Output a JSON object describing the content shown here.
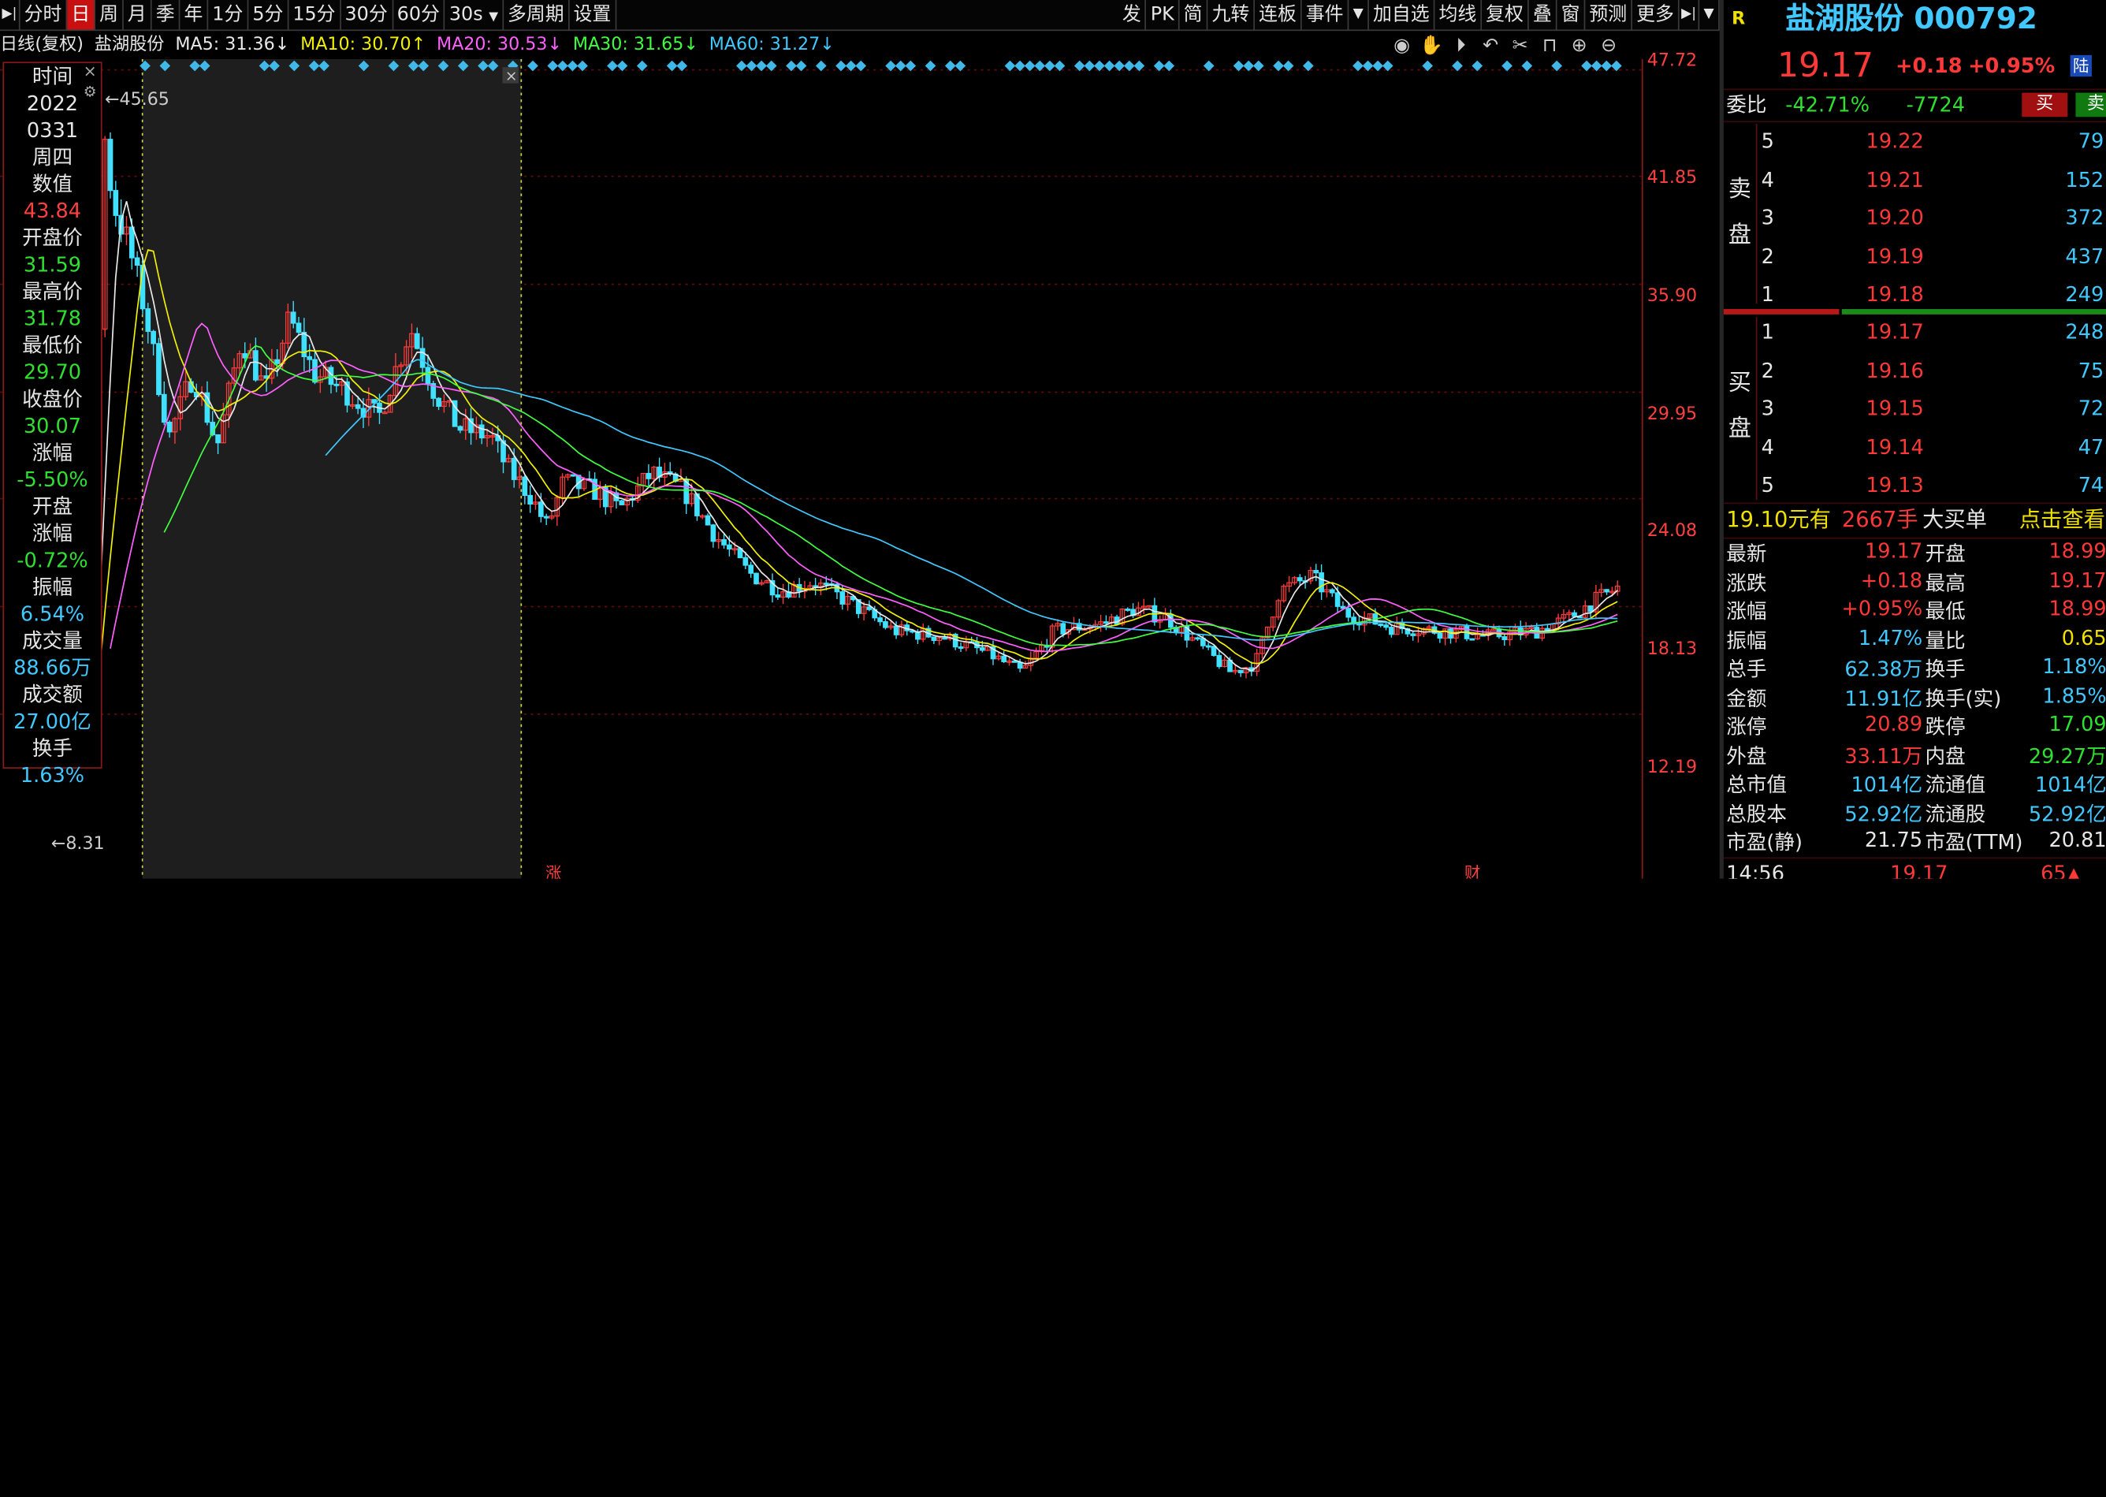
{
  "toolbar": {
    "left_items": [
      "分时",
      "日",
      "周",
      "月",
      "季",
      "年",
      "1分",
      "5分",
      "15分",
      "30分",
      "60分",
      "30s",
      "多周期",
      "设置"
    ],
    "active": "日",
    "right_items": [
      "发",
      "PK",
      "简",
      "九转",
      "连板",
      "事件",
      "加自选",
      "均线",
      "复权",
      "叠",
      "窗",
      "预测",
      "更多"
    ]
  },
  "chart_header": {
    "period": "日线(复权)",
    "stock": "盐湖股份",
    "ma5": "MA5: 31.36↓",
    "ma10": "MA10: 30.70↑",
    "ma20": "MA20: 30.53↓",
    "ma30": "MA30: 31.65↓",
    "ma60": "MA60: 31.27↓"
  },
  "chart_icons": [
    "eye-icon",
    "hand-icon",
    "play-icon",
    "undo-icon",
    "scissors-icon",
    "lock-icon",
    "zoom-in-icon",
    "zoom-out-icon"
  ],
  "chart_markers": {
    "high": "←45.65",
    "low": "←8.31",
    "bottom_left": "涨",
    "bottom_right": "财"
  },
  "price_axis": [
    "47.72",
    "41.85",
    "35.90",
    "29.95",
    "24.08",
    "18.13",
    "12.19"
  ],
  "chart_data": {
    "type": "candlestick",
    "ylim": [
      8.31,
      47.72
    ],
    "series": [
      {
        "name": "MA5",
        "color": "#e8e8e8"
      },
      {
        "name": "MA10",
        "color": "#f0f000"
      },
      {
        "name": "MA20",
        "color": "#ff60ff"
      },
      {
        "name": "MA30",
        "color": "#40ff40"
      },
      {
        "name": "MA60",
        "color": "#40c8ff"
      }
    ],
    "close_path": [
      [
        0.0,
        10.5
      ],
      [
        0.03,
        11.0
      ],
      [
        0.05,
        11.2
      ],
      [
        0.06,
        44.0
      ],
      [
        0.065,
        40.5
      ],
      [
        0.075,
        38.0
      ],
      [
        0.085,
        34.5
      ],
      [
        0.1,
        27.5
      ],
      [
        0.115,
        31.0
      ],
      [
        0.13,
        27.0
      ],
      [
        0.145,
        33.0
      ],
      [
        0.16,
        30.0
      ],
      [
        0.175,
        34.0
      ],
      [
        0.19,
        31.0
      ],
      [
        0.21,
        30.0
      ],
      [
        0.23,
        28.5
      ],
      [
        0.25,
        33.5
      ],
      [
        0.265,
        30.0
      ],
      [
        0.28,
        28.0
      ],
      [
        0.3,
        27.5
      ],
      [
        0.31,
        25.8
      ],
      [
        0.325,
        24.2
      ],
      [
        0.335,
        22.5
      ],
      [
        0.345,
        25.0
      ],
      [
        0.365,
        24.5
      ],
      [
        0.38,
        23.5
      ],
      [
        0.4,
        25.5
      ],
      [
        0.42,
        24.5
      ],
      [
        0.44,
        22.0
      ],
      [
        0.46,
        20.0
      ],
      [
        0.48,
        19.0
      ],
      [
        0.5,
        19.5
      ],
      [
        0.52,
        18.5
      ],
      [
        0.55,
        16.8
      ],
      [
        0.58,
        16.5
      ],
      [
        0.61,
        15.5
      ],
      [
        0.63,
        14.5
      ],
      [
        0.65,
        16.8
      ],
      [
        0.68,
        17.2
      ],
      [
        0.7,
        18.0
      ],
      [
        0.72,
        17.5
      ],
      [
        0.74,
        16.0
      ],
      [
        0.76,
        14.5
      ],
      [
        0.775,
        15.0
      ],
      [
        0.79,
        19.0
      ],
      [
        0.81,
        19.8
      ],
      [
        0.83,
        17.8
      ],
      [
        0.86,
        17.0
      ],
      [
        0.89,
        16.8
      ],
      [
        0.92,
        16.5
      ],
      [
        0.95,
        16.8
      ],
      [
        0.97,
        17.5
      ],
      [
        0.985,
        18.4
      ],
      [
        1.0,
        19.17
      ]
    ]
  },
  "info_panel": [
    {
      "label": "时间",
      "value": "2022",
      "cls": "vw"
    },
    {
      "label": "",
      "value": "0331",
      "cls": "vw"
    },
    {
      "label": "",
      "value": "周四",
      "cls": "vw"
    },
    {
      "label": "数值",
      "value": "43.84",
      "cls": "vr"
    },
    {
      "label": "开盘价",
      "value": "31.59",
      "cls": "vg"
    },
    {
      "label": "最高价",
      "value": "31.78",
      "cls": "vg"
    },
    {
      "label": "最低价",
      "value": "29.70",
      "cls": "vg"
    },
    {
      "label": "收盘价",
      "value": "30.07",
      "cls": "vg"
    },
    {
      "label": "涨幅",
      "value": "-5.50%",
      "cls": "vg"
    },
    {
      "label": "开盘",
      "value": "涨幅",
      "cls": "vw"
    },
    {
      "label": "",
      "value": "-0.72%",
      "cls": "vg"
    },
    {
      "label": "振幅",
      "value": "6.54%",
      "cls": "vc"
    },
    {
      "label": "成交量",
      "value": "88.66万",
      "cls": "vc"
    },
    {
      "label": "成交额",
      "value": "27.00亿",
      "cls": "vc"
    },
    {
      "label": "换手",
      "value": "1.63%",
      "cls": "vc"
    }
  ],
  "quote": {
    "badge": "R",
    "name_code": "盐湖股份 000792",
    "price": "19.17",
    "change": "+0.18",
    "pct": "+0.95%",
    "lu": "陆",
    "weibi_label": "委比",
    "weibi_pct": "-42.71%",
    "weibi_num": "-7724",
    "buy_btn": "买",
    "sell_btn": "卖",
    "ask_label": "卖盘",
    "bid_label": "买盘",
    "asks": [
      {
        "lvl": "5",
        "price": "19.22",
        "vol": "79"
      },
      {
        "lvl": "4",
        "price": "19.21",
        "vol": "152"
      },
      {
        "lvl": "3",
        "price": "19.20",
        "vol": "372"
      },
      {
        "lvl": "2",
        "price": "19.19",
        "vol": "437"
      },
      {
        "lvl": "1",
        "price": "19.18",
        "vol": "249"
      }
    ],
    "bids": [
      {
        "lvl": "1",
        "price": "19.17",
        "vol": "248"
      },
      {
        "lvl": "2",
        "price": "19.16",
        "vol": "75"
      },
      {
        "lvl": "3",
        "price": "19.15",
        "vol": "72"
      },
      {
        "lvl": "4",
        "price": "19.14",
        "vol": "47"
      },
      {
        "lvl": "5",
        "price": "19.13",
        "vol": "74"
      }
    ],
    "bigorder": {
      "a": "19.10元有",
      "b": "2667手",
      "c": "大买单",
      "d": "点击查看"
    },
    "stats": [
      [
        "最新",
        "19.17",
        "red",
        "开盘",
        "18.99",
        "red"
      ],
      [
        "涨跌",
        "+0.18",
        "red",
        "最高",
        "19.17",
        "red"
      ],
      [
        "涨幅",
        "+0.95%",
        "red",
        "最低",
        "18.99",
        "red"
      ],
      [
        "振幅",
        "1.47%",
        "cyn",
        "量比",
        "0.65",
        "yel"
      ],
      [
        "总手",
        "62.38万",
        "cyn",
        "换手",
        "1.18%",
        "cyn"
      ],
      [
        "金额",
        "11.91亿",
        "cyn",
        "换手(实)",
        "1.85%",
        "cyn"
      ],
      [
        "涨停",
        "20.89",
        "red",
        "跌停",
        "17.09",
        "grn"
      ],
      [
        "外盘",
        "33.11万",
        "red",
        "内盘",
        "29.27万",
        "grn"
      ],
      [
        "总市值",
        "1014亿",
        "cyn",
        "流通值",
        "1014亿",
        "cyn"
      ],
      [
        "总股本",
        "52.92亿",
        "cyn",
        "流通股",
        "52.92亿",
        "cyn"
      ],
      [
        "市盈(静)",
        "21.75",
        "wht",
        "市盈(TTM)",
        "20.81",
        "wht"
      ]
    ],
    "last_tick": {
      "time": "14:56",
      "price": "19.17",
      "vol": "65"
    }
  }
}
